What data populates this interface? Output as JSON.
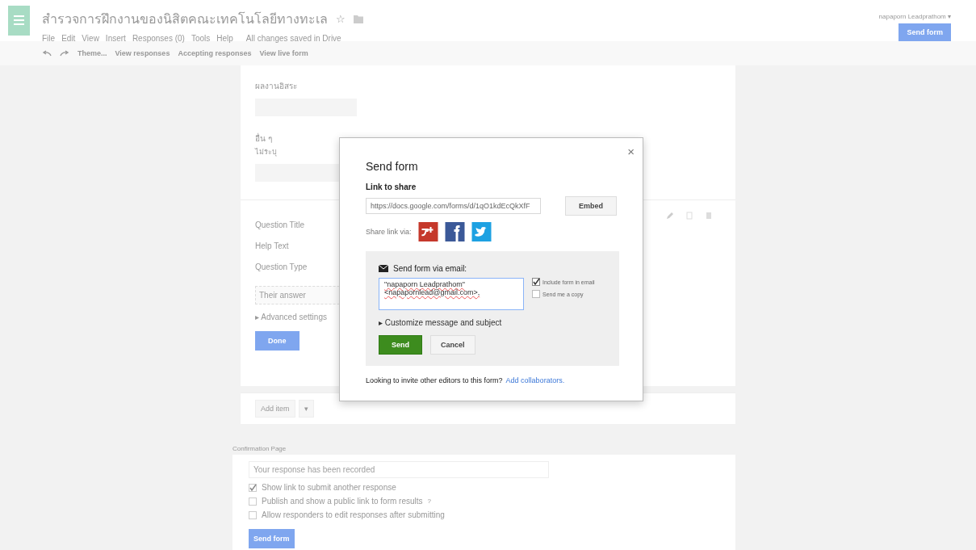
{
  "header": {
    "title": "สำรวจการฝึกงานของนิสิตคณะเทคโนโลยีทางทะเล",
    "star": "☆",
    "menu": [
      "File",
      "Edit",
      "View",
      "Insert",
      "Responses (0)",
      "Tools",
      "Help"
    ],
    "save_status": "All changes saved in Drive",
    "toolbar": [
      {
        "label": "Theme..."
      },
      {
        "label": "View responses"
      },
      {
        "label": "Accepting responses"
      },
      {
        "label": "View live form"
      }
    ],
    "user": "napaporn Leadprathom ▾",
    "send_button": "Send form"
  },
  "form": {
    "fields": [
      {
        "label": "ผลงานอิสระ"
      },
      {
        "label": "อื่น ๆ",
        "help": "ไม่ระบุ"
      }
    ],
    "editor": {
      "rows": [
        "Question Title",
        "Help Text",
        "Question Type"
      ],
      "answer_placeholder": "Their answer",
      "advanced": "▸ Advanced settings",
      "done_button": "Done"
    },
    "add_item": "Add item",
    "add_caret": "▾"
  },
  "confirmation": {
    "heading": "Confirmation Page",
    "placeholder": "Your response has been recorded",
    "options": [
      {
        "label": "Show link to submit another response",
        "checked": true
      },
      {
        "label": "Publish and show a public link to form results",
        "checked": false,
        "hint": "?"
      },
      {
        "label": "Allow responders to edit responses after submitting",
        "checked": false
      }
    ],
    "send_button": "Send form"
  },
  "dialog": {
    "title": "Send form",
    "close": "×",
    "link_label": "Link to share",
    "link_value": "https://docs.google.com/forms/d/1qO1kdEcQkXfF",
    "embed_button": "Embed",
    "share_label": "Share link via:",
    "email": {
      "heading": "Send form via email:",
      "recipients": [
        "\"napaporn Leadprathom\"",
        "<napapornlead@gmail.com>, "
      ],
      "options": [
        {
          "label": "Include form in email",
          "checked": true
        },
        {
          "label": "Send me a copy",
          "checked": false
        }
      ],
      "customize": "▸ Customize message and subject",
      "send_button": "Send",
      "cancel_button": "Cancel"
    },
    "footer": "Looking to invite other editors to this form?",
    "footer_link": "Add collaborators."
  }
}
